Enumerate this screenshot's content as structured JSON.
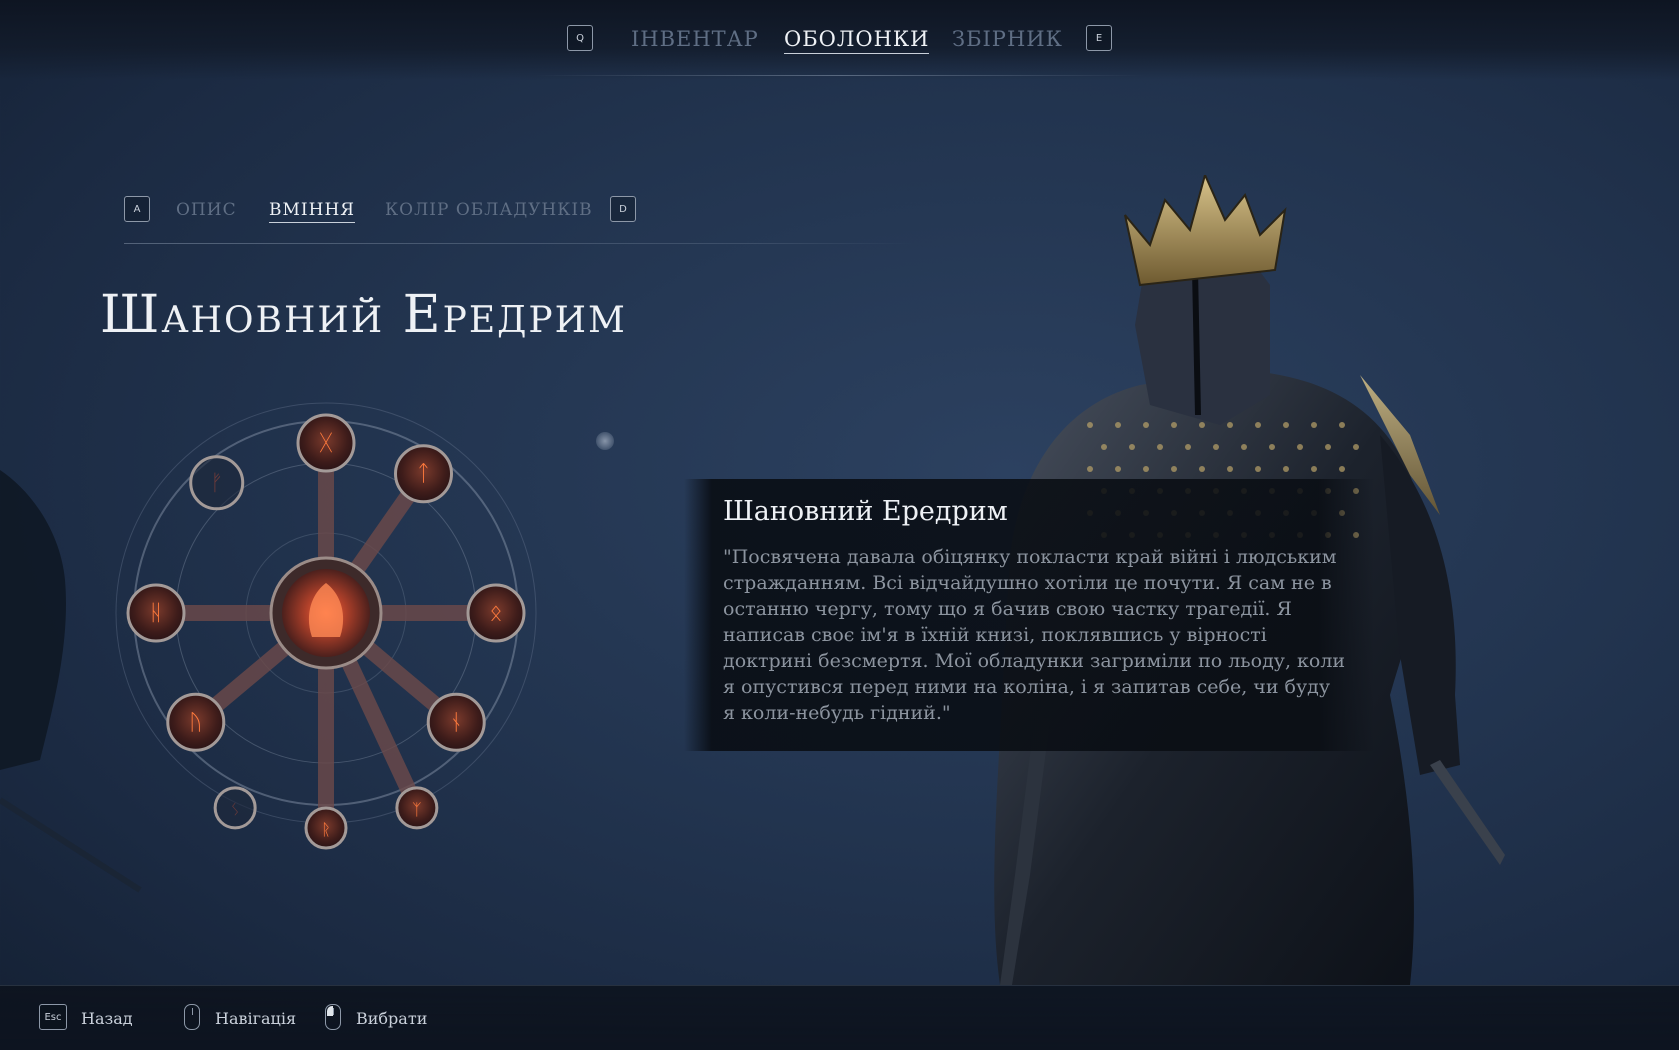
{
  "top_nav": {
    "prev_key": "Q",
    "next_key": "E",
    "tabs": [
      {
        "label": "ІНВЕНТАР",
        "active": false
      },
      {
        "label": "ОБОЛОНКИ",
        "active": true
      },
      {
        "label": "ЗБІРНИК",
        "active": false
      }
    ]
  },
  "sub_nav": {
    "prev_key": "A",
    "next_key": "D",
    "tabs": [
      {
        "label": "ОПИС",
        "active": false
      },
      {
        "label": "ВМІННЯ",
        "active": true
      },
      {
        "label": "КОЛІР ОБЛАДУНКІВ",
        "active": false
      }
    ]
  },
  "character": {
    "name": "Шановний Ередрим"
  },
  "rune_wheel": {
    "nodes": [
      "ᚷ",
      "ᛏ",
      "ᛟ",
      "ᚾ",
      "ᚢ",
      "ᚺ",
      "ᚠ",
      "ᚱ",
      "ᛉ",
      "ᛊ"
    ],
    "glow_color": "#ff7a3c",
    "node_color": "#5a2a24"
  },
  "tooltip": {
    "title": "Шановний Ередрим",
    "text": "\"Посвячена давала обіцянку покласти край війні і людським стражданням. Всі відчайдушно хотіли це почути. Я сам не в останню чергу, тому що я бачив свою частку трагедії. Я написав своє ім'я в їхній книзі, поклявшись у вірності доктрині безсмертя. Мої обладунки загриміли по льоду, коли я опустився перед ними на коліна, і я запитав себе, чи буду я коли-небудь гідний.\""
  },
  "footer": {
    "back_key": "Esc",
    "back_label": "Назад",
    "nav_label": "Навігація",
    "select_label": "Вибрати"
  },
  "colors": {
    "background": "#22344f",
    "text_active": "#eef1f5",
    "text_inactive": "#5f6e84",
    "rune_glow": "#ff7a3c"
  }
}
